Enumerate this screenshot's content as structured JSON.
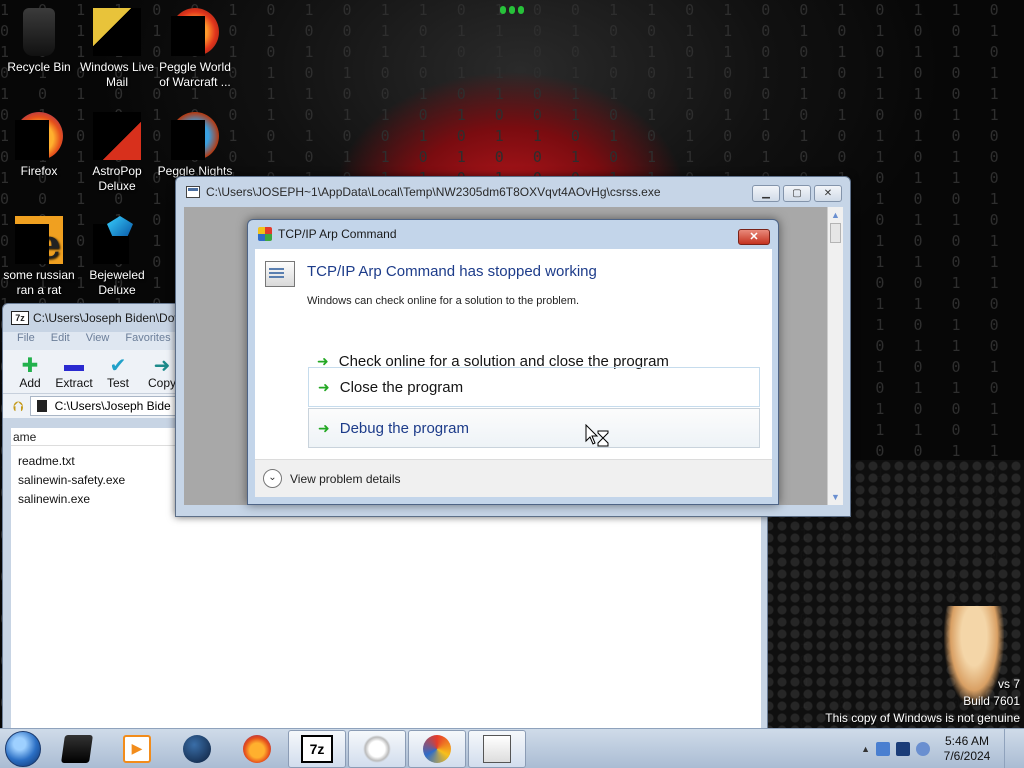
{
  "desktop": {
    "icons": [
      {
        "label": "Recycle Bin",
        "icon": "recycle-bin-icon"
      },
      {
        "label": "Windows Live Mail",
        "icon": "windows-live-mail-icon"
      },
      {
        "label": "Peggle World of Warcraft ...",
        "icon": "peggle-wow-icon"
      },
      {
        "label": "Firefox",
        "icon": "firefox-icon"
      },
      {
        "label": "AstroPop Deluxe",
        "icon": "astropop-icon"
      },
      {
        "label": "Peggle Nights",
        "icon": "peggle-nights-icon"
      },
      {
        "label": "some russian ran a rat",
        "icon": "rat-file-icon"
      },
      {
        "label": "Bejeweled Deluxe",
        "icon": "bejeweled-icon"
      }
    ],
    "genuine_line1": "vs 7",
    "genuine_line2": "Build 7601",
    "genuine_line3": "This copy of Windows is not genuine"
  },
  "zip_window": {
    "title": "C:\\Users\\Joseph Biden\\Dov",
    "menu": [
      "File",
      "Edit",
      "View",
      "Favorites"
    ],
    "toolbar": [
      {
        "label": "Add",
        "icon": "add-icon",
        "glyph": "✚",
        "color": "#22b14c"
      },
      {
        "label": "Extract",
        "icon": "extract-icon",
        "glyph": "▬",
        "color": "#2a2ad0"
      },
      {
        "label": "Test",
        "icon": "test-icon",
        "glyph": "✔",
        "color": "#21a1c9"
      },
      {
        "label": "Copy",
        "icon": "copy-icon",
        "glyph": "➜",
        "color": "#1c8a8a"
      }
    ],
    "address": "C:\\Users\\Joseph Bide",
    "column_header": "ame",
    "files": [
      "readme.txt",
      "salinewin-safety.exe",
      "salinewin.exe"
    ]
  },
  "console_window": {
    "title": "C:\\Users\\JOSEPH~1\\AppData\\Local\\Temp\\NW2305dm6T8OXVqvt4AOvHg\\csrss.exe",
    "minimize": "▁",
    "maximize": "▢",
    "close": "✕"
  },
  "error_dialog": {
    "title": "TCP/IP Arp Command",
    "heading": "TCP/IP Arp Command has stopped working",
    "subtext": "Windows can check online for a solution to the problem.",
    "options": [
      "Check online for a solution and close the program",
      "Close the program",
      "Debug the program"
    ],
    "details": "View problem details",
    "close_glyph": "✕"
  },
  "taskbar": {
    "time": "5:46 AM",
    "date": "7/6/2024",
    "zip_label": "7z",
    "colors": {
      "accent": "#2b6fc4",
      "error_heading": "#1d3c8a",
      "close_red": "#c4321f"
    }
  }
}
